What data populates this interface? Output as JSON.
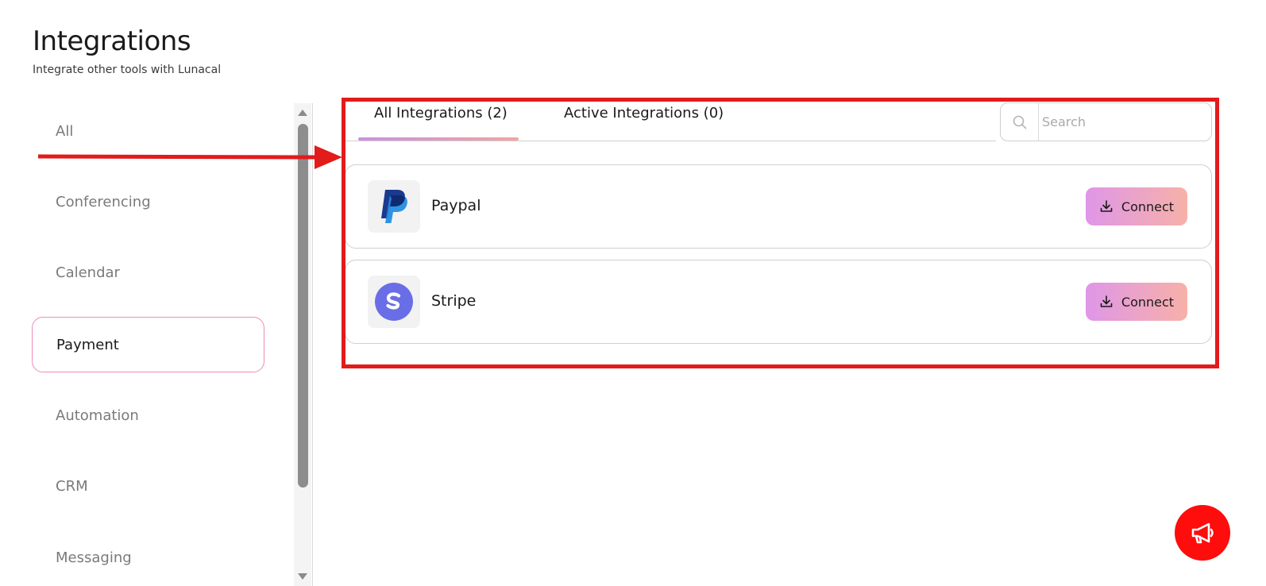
{
  "header": {
    "title": "Integrations",
    "subtitle": "Integrate other tools with Lunacal"
  },
  "sidebar": {
    "items": [
      {
        "label": "All",
        "active": false
      },
      {
        "label": "Conferencing",
        "active": false
      },
      {
        "label": "Calendar",
        "active": false
      },
      {
        "label": "Payment",
        "active": true
      },
      {
        "label": "Automation",
        "active": false
      },
      {
        "label": "CRM",
        "active": false
      },
      {
        "label": "Messaging",
        "active": false
      }
    ]
  },
  "tabs": [
    {
      "label": "All Integrations (2)",
      "active": true
    },
    {
      "label": "Active Integrations (0)",
      "active": false
    }
  ],
  "search": {
    "placeholder": "Search",
    "value": "",
    "icon": "search-icon"
  },
  "integrations": [
    {
      "name": "Paypal",
      "icon": "paypal-logo",
      "action_label": "Connect",
      "action_icon": "download-icon"
    },
    {
      "name": "Stripe",
      "icon": "stripe-logo",
      "action_label": "Connect",
      "action_icon": "download-icon"
    }
  ],
  "fab": {
    "icon": "megaphone-icon"
  },
  "colors": {
    "accent_gradient_start": "#df96e8",
    "accent_gradient_end": "#f7b1a8",
    "annotation_red": "#e21b1b",
    "fab_red": "#ff0c0c",
    "active_border": "#f28ab8"
  }
}
